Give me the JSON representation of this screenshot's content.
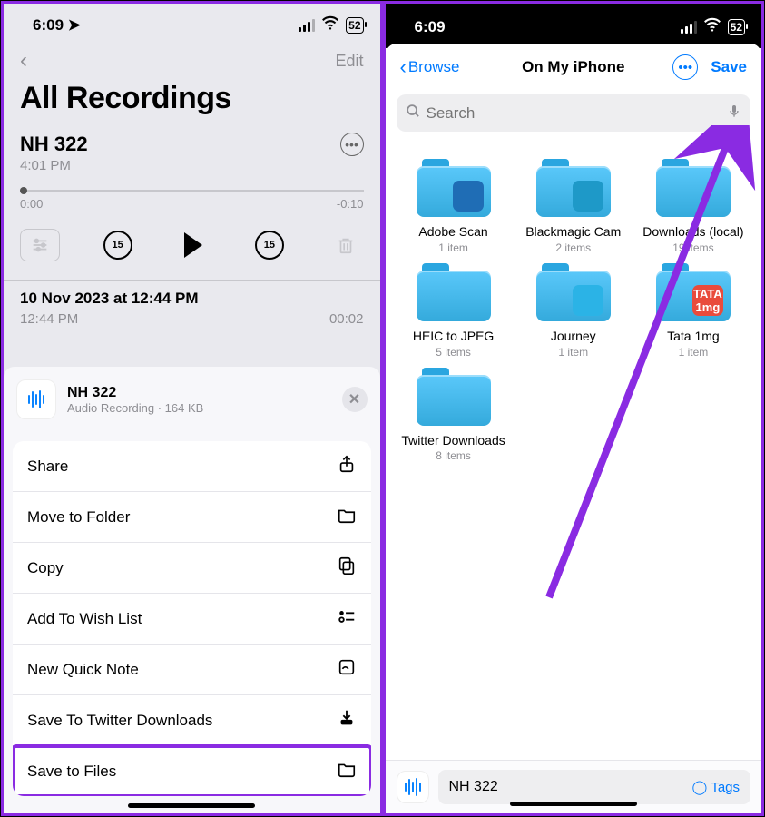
{
  "left": {
    "status": {
      "time": "6:09",
      "battery": "52"
    },
    "nav": {
      "edit": "Edit"
    },
    "title": "All Recordings",
    "recording": {
      "name": "NH 322",
      "time": "4:01 PM",
      "pos": "0:00",
      "rem": "-0:10",
      "skip": "15"
    },
    "item2": {
      "title": "10 Nov 2023 at 12:44 PM",
      "time": "12:44 PM",
      "dur": "00:02"
    },
    "sheet": {
      "name": "NH 322",
      "meta": "Audio Recording · 164 KB",
      "actions": [
        "Share",
        "Move to Folder",
        "Copy",
        "Add To Wish List",
        "New Quick Note",
        "Save To Twitter Downloads",
        "Save to Files"
      ]
    }
  },
  "right": {
    "status": {
      "time": "6:09",
      "battery": "52"
    },
    "nav": {
      "back": "Browse",
      "title": "On My iPhone",
      "save": "Save"
    },
    "search": {
      "placeholder": "Search"
    },
    "folders": [
      {
        "name": "Adobe Scan",
        "meta": "1 item",
        "thumb_bg": "#1f6db5",
        "thumb_text": ""
      },
      {
        "name": "Blackmagic Cam",
        "meta": "2 items",
        "thumb_bg": "#1e99c8",
        "thumb_text": ""
      },
      {
        "name": "Downloads (local)",
        "meta": "19 items",
        "thumb_bg": "",
        "thumb_text": ""
      },
      {
        "name": "HEIC to JPEG",
        "meta": "5 items",
        "thumb_bg": "",
        "thumb_text": ""
      },
      {
        "name": "Journey",
        "meta": "1 item",
        "thumb_bg": "#2bb3e6",
        "thumb_text": ""
      },
      {
        "name": "Tata 1mg",
        "meta": "1 item",
        "thumb_bg": "#e94b3c",
        "thumb_text": "TATA 1mg"
      },
      {
        "name": "Twitter Downloads",
        "meta": "8 items",
        "thumb_bg": "",
        "thumb_text": ""
      }
    ],
    "file": {
      "name": "NH 322",
      "tags": "Tags"
    }
  }
}
